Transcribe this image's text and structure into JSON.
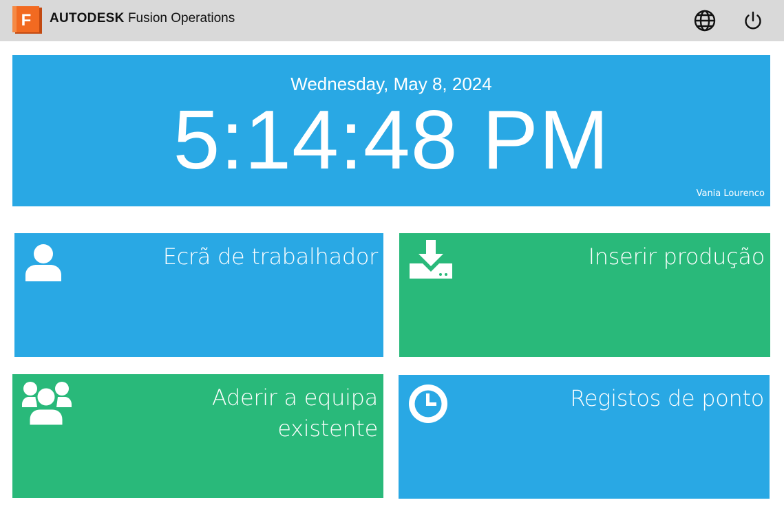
{
  "header": {
    "brand_bold": "AUTODESK",
    "brand_product": "Fusion Operations",
    "logo_letter": "F",
    "logo_icon": "fusion-logo-icon",
    "language_icon": "globe-icon",
    "logout_icon": "power-icon"
  },
  "clock": {
    "date": "Wednesday, May 8, 2024",
    "time": "5:14:48 PM",
    "user": "Vania Lourenco"
  },
  "tiles": [
    {
      "label": "Ecrã de trabalhador",
      "icon": "user-icon",
      "color": "#29a8e4"
    },
    {
      "label": "Inserir produção",
      "icon": "download-tray-icon",
      "color": "#29b97a"
    },
    {
      "label_line1": "Aderir a equipa",
      "label_line2": "existente",
      "icon": "users-group-icon",
      "color": "#29b97a"
    },
    {
      "label": "Registos de ponto",
      "icon": "clock-icon",
      "color": "#29a8e4"
    }
  ],
  "colors": {
    "header_bg": "#d9d9d9",
    "blue": "#29a8e4",
    "green": "#29b97a",
    "logo_orange": "#f26a21"
  }
}
